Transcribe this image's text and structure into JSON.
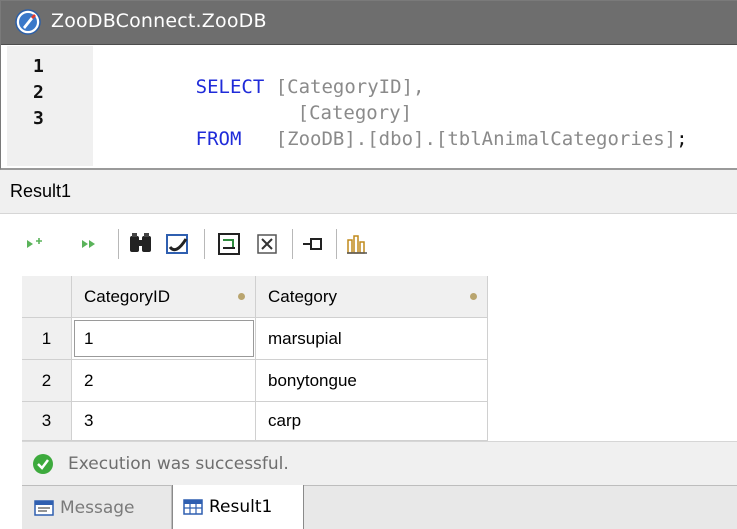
{
  "window": {
    "title": "ZooDBConnect.ZooDB"
  },
  "editor": {
    "line_numbers": [
      "1",
      "2",
      "3"
    ],
    "lines": [
      {
        "keyword": "SELECT",
        "rest": "[CategoryID],",
        "rest_punc": ""
      },
      {
        "keyword": "",
        "rest": "[Category]",
        "rest_punc": ""
      },
      {
        "keyword": "FROM",
        "rest": "[ZooDB].[dbo].[tblAnimalCategories]",
        "rest_punc": ";"
      }
    ]
  },
  "result_panel": {
    "label": "Result1"
  },
  "toolbar": {
    "icons": [
      "execute-step-icon",
      "execute-all-icon",
      "find-icon",
      "bookmark-icon",
      "export-icon",
      "expand-icon",
      "pin-icon",
      "chart-icon"
    ]
  },
  "grid": {
    "columns": [
      "CategoryID",
      "Category"
    ],
    "rows": [
      {
        "num": "1",
        "id": "1",
        "category": "marsupial"
      },
      {
        "num": "2",
        "id": "2",
        "category": "bonytongue"
      },
      {
        "num": "3",
        "id": "3",
        "category": "carp"
      }
    ]
  },
  "status": {
    "message": "Execution was successful."
  },
  "tabs": {
    "message_label": "Message",
    "result_label": "Result1"
  },
  "colors": {
    "title_bar": "#6e6e6e",
    "keyword": "#1f2bd9",
    "identifier": "#8a8a8a",
    "success": "#3daa3d"
  }
}
